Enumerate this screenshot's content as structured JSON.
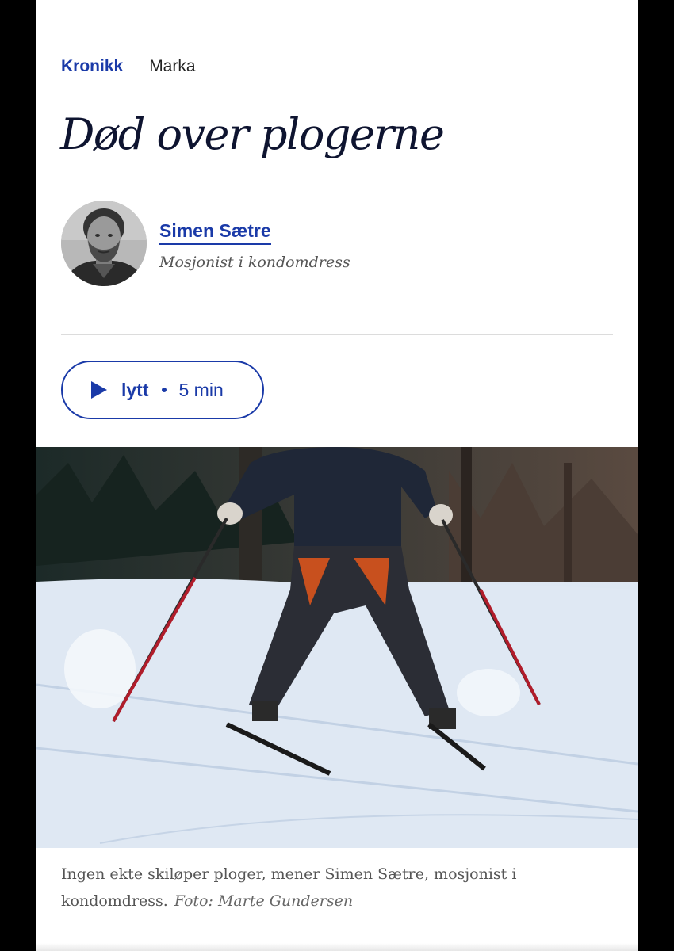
{
  "article": {
    "section": "Kronikk",
    "tag": "Marka",
    "title": "Død over plogerne",
    "author": {
      "name": "Simen Sætre",
      "role": "Mosjonist i kondomdress"
    },
    "listen": {
      "icon": "play-icon",
      "label": "lytt",
      "duration": "5 min"
    },
    "image": {
      "caption": "Ingen ekte skiløper ploger, mener Simen Sætre, mosjonist i kondomdress.",
      "credit": "Foto: Marte Gundersen"
    }
  },
  "colors": {
    "accent": "#1a3aa8",
    "title": "#0e1430",
    "caption": "#555555"
  }
}
